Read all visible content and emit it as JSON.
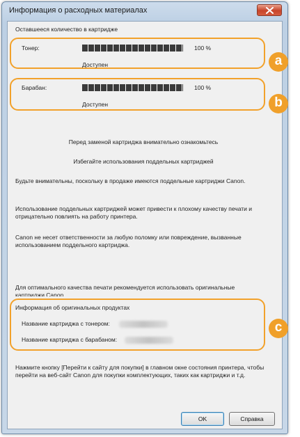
{
  "window": {
    "title": "Информация о расходных материалах"
  },
  "cartridge_section": {
    "label": "Оставшееся количество в картридже",
    "toner": {
      "label": "Тонер:",
      "percent_text": "100 %",
      "level": 1.0,
      "status": "Доступен"
    },
    "drum": {
      "label": "Барабан:",
      "percent_text": "100 %",
      "level": 1.0,
      "status": "Доступен"
    }
  },
  "notice": {
    "line1": "Перед заменой картриджа внимательно ознакомьтесь",
    "line2": "Избегайте использования поддельных картриджей",
    "para1": "Будьте внимательны, поскольку в продаже имеются поддельные картриджи Canon.",
    "para2": "Использование поддельных картриджей может привести к плохому качеству печати и отрицательно повлиять на работу принтера.",
    "para3": "Canon не несет ответственности за любую поломку или повреждение, вызванные использованием поддельного картриджа.",
    "para4": "Для оптимального качества печати рекомендуется использовать оригинальные картриджи Canon."
  },
  "product_info": {
    "label": "Информация об оригинальных продуктах",
    "toner_name_label": "Название картриджа с тонером:",
    "drum_name_label": "Название картриджа с барабаном:"
  },
  "footer_text": "Нажмите кнопку [Перейти к сайту для покупки] в главном окне состояния принтера, чтобы перейти на веб-сайт Canon для покупки комплектующих, таких как картриджи и т.д.",
  "buttons": {
    "ok": "OK",
    "help": "Справка"
  },
  "callouts": {
    "a": "a",
    "b": "b",
    "c": "c"
  },
  "colors": {
    "callout": "#f2a12a",
    "close_button": "#c8452a"
  }
}
